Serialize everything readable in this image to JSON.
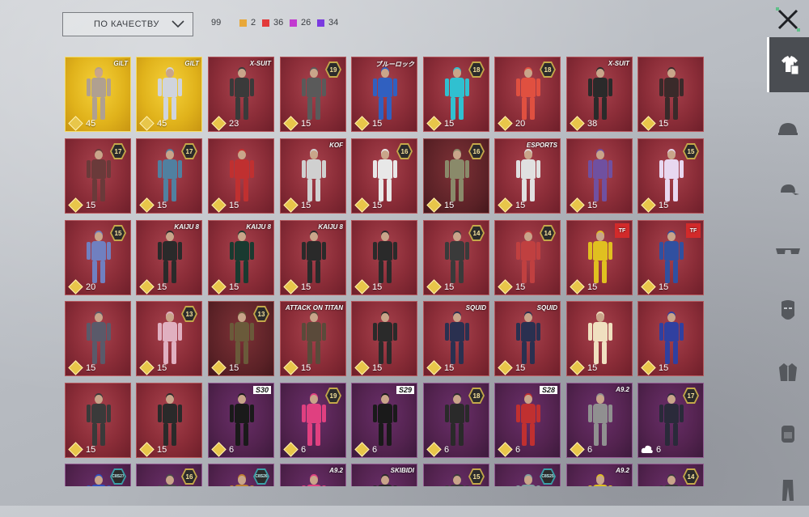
{
  "sort": {
    "label": "ПО КАЧЕСТВУ",
    "icon": "chevron-down-icon"
  },
  "counts": {
    "total": "99",
    "rarities": [
      {
        "value": "2",
        "color": "#e8a83a"
      },
      {
        "value": "36",
        "color": "#e23a3a"
      },
      {
        "value": "26",
        "color": "#c23ad0"
      },
      {
        "value": "34",
        "color": "#7a3ae0"
      }
    ]
  },
  "close_icon": "close-icon",
  "sidebar": {
    "items": [
      {
        "icon": "outfit-icon",
        "active": true
      },
      {
        "icon": "helmet-icon",
        "active": false
      },
      {
        "icon": "cap-icon",
        "active": false
      },
      {
        "icon": "glasses-icon",
        "active": false
      },
      {
        "icon": "mask-icon",
        "active": false
      },
      {
        "icon": "jacket-icon",
        "active": false
      },
      {
        "icon": "backpack-icon",
        "active": false
      },
      {
        "icon": "pants-icon",
        "active": false
      }
    ]
  },
  "rows": [
    [
      {
        "bg": "gold",
        "price": "45",
        "tag": "GILT",
        "tagtype": "tag",
        "fig": "#b0a090"
      },
      {
        "bg": "gold",
        "price": "45",
        "tag": "GILT",
        "tagtype": "tag",
        "fig": "#d0d4dc"
      },
      {
        "bg": "red",
        "price": "23",
        "tag": "X-SUIT",
        "tagtype": "tag",
        "fig": "#3a3a3a"
      },
      {
        "bg": "red",
        "price": "15",
        "tag": "19",
        "tagtype": "level",
        "fig": "#5a5a5a"
      },
      {
        "bg": "red",
        "price": "15",
        "tag": "ブルーロック",
        "tagtype": "tag",
        "fig": "#3060c0"
      },
      {
        "bg": "red",
        "price": "15",
        "tag": "18",
        "tagtype": "level",
        "fig": "#30c0d0"
      },
      {
        "bg": "red",
        "price": "20",
        "tag": "18",
        "tagtype": "level",
        "fig": "#e05040"
      },
      {
        "bg": "red",
        "price": "38",
        "tag": "X-SUIT",
        "tagtype": "tag",
        "fig": "#2a2a2a"
      },
      {
        "bg": "red",
        "price": "15",
        "tag": "",
        "tagtype": "none",
        "fig": "#3a2a2a"
      }
    ],
    [
      {
        "bg": "red",
        "price": "15",
        "tag": "17",
        "tagtype": "level",
        "fig": "#6a3a3a"
      },
      {
        "bg": "red",
        "price": "15",
        "tag": "17",
        "tagtype": "level",
        "fig": "#5080a0"
      },
      {
        "bg": "red",
        "price": "15",
        "tag": "",
        "tagtype": "none",
        "fig": "#c03030"
      },
      {
        "bg": "red",
        "price": "15",
        "tag": "KOF",
        "tagtype": "tag",
        "fig": "#d0d0d0"
      },
      {
        "bg": "red",
        "price": "15",
        "tag": "16",
        "tagtype": "level",
        "fig": "#e8e8e8"
      },
      {
        "bg": "dark",
        "price": "15",
        "tag": "16",
        "tagtype": "level",
        "fig": "#8a8a6a"
      },
      {
        "bg": "red",
        "price": "15",
        "tag": "ESPORTS",
        "tagtype": "tag",
        "fig": "#e0e0e0"
      },
      {
        "bg": "red",
        "price": "15",
        "tag": "",
        "tagtype": "none",
        "fig": "#7050a0"
      },
      {
        "bg": "red",
        "price": "15",
        "tag": "15",
        "tagtype": "level",
        "fig": "#e8d8f0"
      }
    ],
    [
      {
        "bg": "red",
        "price": "20",
        "tag": "15",
        "tagtype": "level",
        "fig": "#7080c0"
      },
      {
        "bg": "red",
        "price": "15",
        "tag": "KAIJU 8",
        "tagtype": "tag",
        "fig": "#2a2a2a"
      },
      {
        "bg": "red",
        "price": "15",
        "tag": "KAIJU 8",
        "tagtype": "tag",
        "fig": "#1a3a30"
      },
      {
        "bg": "red",
        "price": "15",
        "tag": "KAIJU 8",
        "tagtype": "tag",
        "fig": "#2a2a2a"
      },
      {
        "bg": "red",
        "price": "15",
        "tag": "",
        "tagtype": "none",
        "fig": "#2a2a2a"
      },
      {
        "bg": "red",
        "price": "15",
        "tag": "14",
        "tagtype": "level",
        "fig": "#3a3a3a"
      },
      {
        "bg": "red",
        "price": "15",
        "tag": "14",
        "tagtype": "level",
        "fig": "#c04040"
      },
      {
        "bg": "red",
        "price": "15",
        "tag": "TF",
        "tagtype": "logo",
        "fig": "#e0c020"
      },
      {
        "bg": "red",
        "price": "15",
        "tag": "TF",
        "tagtype": "logo",
        "fig": "#3050a0"
      }
    ],
    [
      {
        "bg": "red",
        "price": "15",
        "tag": "",
        "tagtype": "none",
        "fig": "#5a5a6a"
      },
      {
        "bg": "red",
        "price": "15",
        "tag": "13",
        "tagtype": "level",
        "fig": "#e0b0c0"
      },
      {
        "bg": "dark",
        "price": "15",
        "tag": "13",
        "tagtype": "level",
        "fig": "#6a5a3a"
      },
      {
        "bg": "red",
        "price": "15",
        "tag": "ATTACK ON TITAN",
        "tagtype": "tag",
        "fig": "#5a4a3a"
      },
      {
        "bg": "red",
        "price": "15",
        "tag": "",
        "tagtype": "none",
        "fig": "#2a2a2a"
      },
      {
        "bg": "red",
        "price": "15",
        "tag": "SQUID",
        "tagtype": "tag",
        "fig": "#2a3050"
      },
      {
        "bg": "red",
        "price": "15",
        "tag": "SQUID",
        "tagtype": "tag",
        "fig": "#2a3050"
      },
      {
        "bg": "red",
        "price": "15",
        "tag": "",
        "tagtype": "none",
        "fig": "#f0e0c0"
      },
      {
        "bg": "red",
        "price": "15",
        "tag": "",
        "tagtype": "none",
        "fig": "#3040a0"
      }
    ],
    [
      {
        "bg": "red",
        "price": "15",
        "tag": "",
        "tagtype": "none",
        "fig": "#3a3a3a"
      },
      {
        "bg": "red",
        "price": "15",
        "tag": "",
        "tagtype": "none",
        "fig": "#2a2a2a"
      },
      {
        "bg": "purple",
        "price": "6",
        "tag": "S30",
        "tagtype": "season",
        "fig": "#1a1a1a"
      },
      {
        "bg": "purple",
        "price": "6",
        "tag": "19",
        "tagtype": "level",
        "fig": "#e04080"
      },
      {
        "bg": "purple",
        "price": "6",
        "tag": "S29",
        "tagtype": "season",
        "fig": "#1a1a1a"
      },
      {
        "bg": "purple",
        "price": "6",
        "tag": "18",
        "tagtype": "level",
        "fig": "#2a2a2a"
      },
      {
        "bg": "purple",
        "price": "6",
        "tag": "S28",
        "tagtype": "season",
        "fig": "#c03030"
      },
      {
        "bg": "purple",
        "price": "6",
        "tag": "A9.2",
        "tagtype": "tag",
        "fig": "#909090"
      },
      {
        "bg": "purple",
        "price": "6",
        "tag": "17",
        "tagtype": "level",
        "fig": "#2a2a3a",
        "cloud": true
      }
    ],
    [
      {
        "bg": "purple",
        "price": "",
        "tag": "C8S27",
        "tagtype": "teal",
        "fig": "#3050c0"
      },
      {
        "bg": "purple",
        "price": "",
        "tag": "16",
        "tagtype": "level",
        "fig": "#4a4a4a"
      },
      {
        "bg": "purple",
        "price": "",
        "tag": "C8S26",
        "tagtype": "teal",
        "fig": "#c08030"
      },
      {
        "bg": "purple",
        "price": "",
        "tag": "A9.2",
        "tagtype": "tag",
        "fig": "#e04080"
      },
      {
        "bg": "purple",
        "price": "",
        "tag": "SKIBIDI",
        "tagtype": "tag",
        "fig": "#2a2a2a"
      },
      {
        "bg": "purple",
        "price": "",
        "tag": "15",
        "tagtype": "level",
        "fig": "#3a3a3a"
      },
      {
        "bg": "purple",
        "price": "",
        "tag": "C8S25",
        "tagtype": "teal",
        "fig": "#80a0a0"
      },
      {
        "bg": "purple",
        "price": "",
        "tag": "A9.2",
        "tagtype": "tag",
        "fig": "#e0c020"
      },
      {
        "bg": "purple",
        "price": "",
        "tag": "14",
        "tagtype": "level",
        "fig": "#3a3a3a"
      }
    ]
  ]
}
